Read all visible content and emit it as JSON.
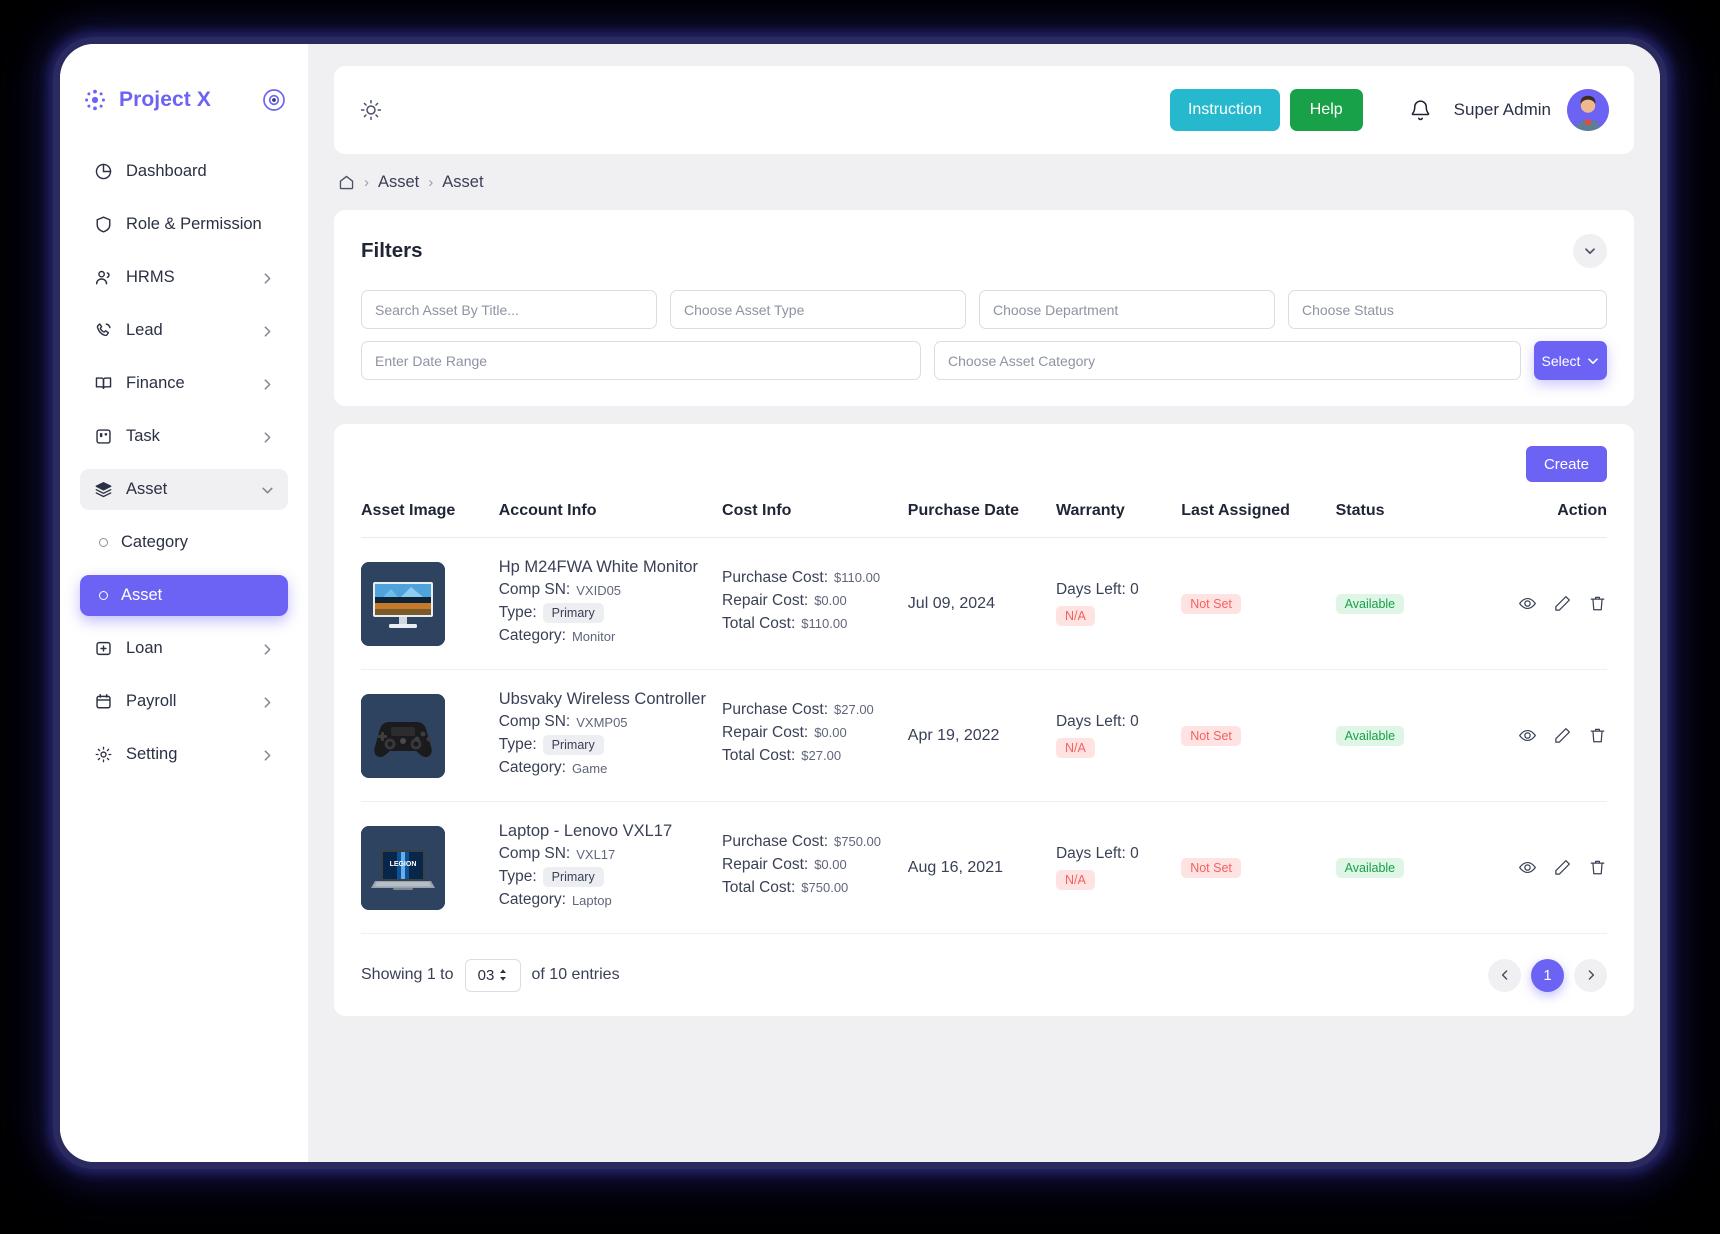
{
  "brand": {
    "name": "Project X",
    "logo_color": "#6c63f5",
    "toggle_icon": "target-toggle-icon"
  },
  "sidebar": {
    "items": [
      {
        "label": "Dashboard",
        "icon": "pie-chart-icon",
        "has_chevron": false,
        "state": "default"
      },
      {
        "label": "Role & Permission",
        "icon": "shield-icon",
        "has_chevron": false,
        "state": "default"
      },
      {
        "label": "HRMS",
        "icon": "users-icon",
        "has_chevron": true,
        "state": "default"
      },
      {
        "label": "Lead",
        "icon": "phone-call-icon",
        "has_chevron": true,
        "state": "default"
      },
      {
        "label": "Finance",
        "icon": "book-icon",
        "has_chevron": true,
        "state": "default"
      },
      {
        "label": "Task",
        "icon": "task-board-icon",
        "has_chevron": true,
        "state": "default"
      },
      {
        "label": "Asset",
        "icon": "layers-icon",
        "has_chevron": true,
        "state": "expanded"
      }
    ],
    "sub_items": [
      {
        "label": "Category",
        "icon": "circle-icon",
        "state": "default"
      },
      {
        "label": "Asset",
        "icon": "circle-icon",
        "state": "active"
      }
    ],
    "items_after": [
      {
        "label": "Loan",
        "icon": "loan-box-icon",
        "has_chevron": true,
        "state": "default"
      },
      {
        "label": "Payroll",
        "icon": "calendar-icon",
        "has_chevron": true,
        "state": "default"
      },
      {
        "label": "Setting",
        "icon": "gear-icon",
        "has_chevron": true,
        "state": "default"
      }
    ],
    "active_color": "#6c63f5"
  },
  "topbar": {
    "theme_icon": "sun-icon",
    "instruction_label": "Instruction",
    "instruction_color": "#26b8cc",
    "help_label": "Help",
    "help_color": "#18a148",
    "notification_icon": "bell-icon",
    "user_name": "Super Admin",
    "avatar": "user-avatar"
  },
  "breadcrumb": {
    "home_icon": "home-icon",
    "separator": "›",
    "items": [
      "Asset",
      "Asset"
    ]
  },
  "filters": {
    "title": "Filters",
    "collapse_icon": "chevron-down-icon",
    "search_placeholder": "Search Asset By Title...",
    "asset_type_placeholder": "Choose Asset Type",
    "department_placeholder": "Choose Department",
    "status_placeholder": "Choose Status",
    "date_range_placeholder": "Enter Date Range",
    "asset_category_placeholder": "Choose Asset Category",
    "select_label": "Select",
    "select_color": "#6c63f5"
  },
  "table": {
    "create_label": "Create",
    "create_color": "#6c63f5",
    "headers": [
      "Asset Image",
      "Account Info",
      "Cost Info",
      "Purchase Date",
      "Warranty",
      "Last Assigned",
      "Status",
      "Action"
    ],
    "labels": {
      "comp_sn": "Comp SN:",
      "type": "Type:",
      "category": "Category:",
      "purchase_cost": "Purchase Cost:",
      "repair_cost": "Repair Cost:",
      "total_cost": "Total Cost:",
      "days_left": "Days Left:"
    },
    "rows": [
      {
        "image": "monitor-thumbnail",
        "title": "Hp M24FWA White Monitor",
        "comp_sn": "VXID05",
        "type": "Primary",
        "category": "Monitor",
        "purchase_cost": "$110.00",
        "repair_cost": "$0.00",
        "total_cost": "$110.00",
        "purchase_date": "Jul 09, 2024",
        "days_left": "0",
        "warranty_badge": "N/A",
        "last_assigned": "Not Set",
        "status": "Available"
      },
      {
        "image": "game-controller-thumbnail",
        "title": "Ubsvaky Wireless Controller",
        "comp_sn": "VXMP05",
        "type": "Primary",
        "category": "Game",
        "purchase_cost": "$27.00",
        "repair_cost": "$0.00",
        "total_cost": "$27.00",
        "purchase_date": "Apr 19, 2022",
        "days_left": "0",
        "warranty_badge": "N/A",
        "last_assigned": "Not Set",
        "status": "Available"
      },
      {
        "image": "laptop-thumbnail",
        "title": "Laptop - Lenovo VXL17",
        "comp_sn": "VXL17",
        "type": "Primary",
        "category": "Laptop",
        "purchase_cost": "$750.00",
        "repair_cost": "$0.00",
        "total_cost": "$750.00",
        "purchase_date": "Aug 16, 2021",
        "days_left": "0",
        "warranty_badge": "N/A",
        "last_assigned": "Not Set",
        "status": "Available"
      }
    ],
    "action_icons": [
      "eye-icon",
      "pencil-icon",
      "trash-icon"
    ]
  },
  "footer": {
    "showing_prefix": "Showing 1 to",
    "per_page": "03",
    "showing_suffix": "of 10 entries",
    "prev_icon": "chevron-left-icon",
    "next_icon": "chevron-right-icon",
    "current_page": "1"
  }
}
